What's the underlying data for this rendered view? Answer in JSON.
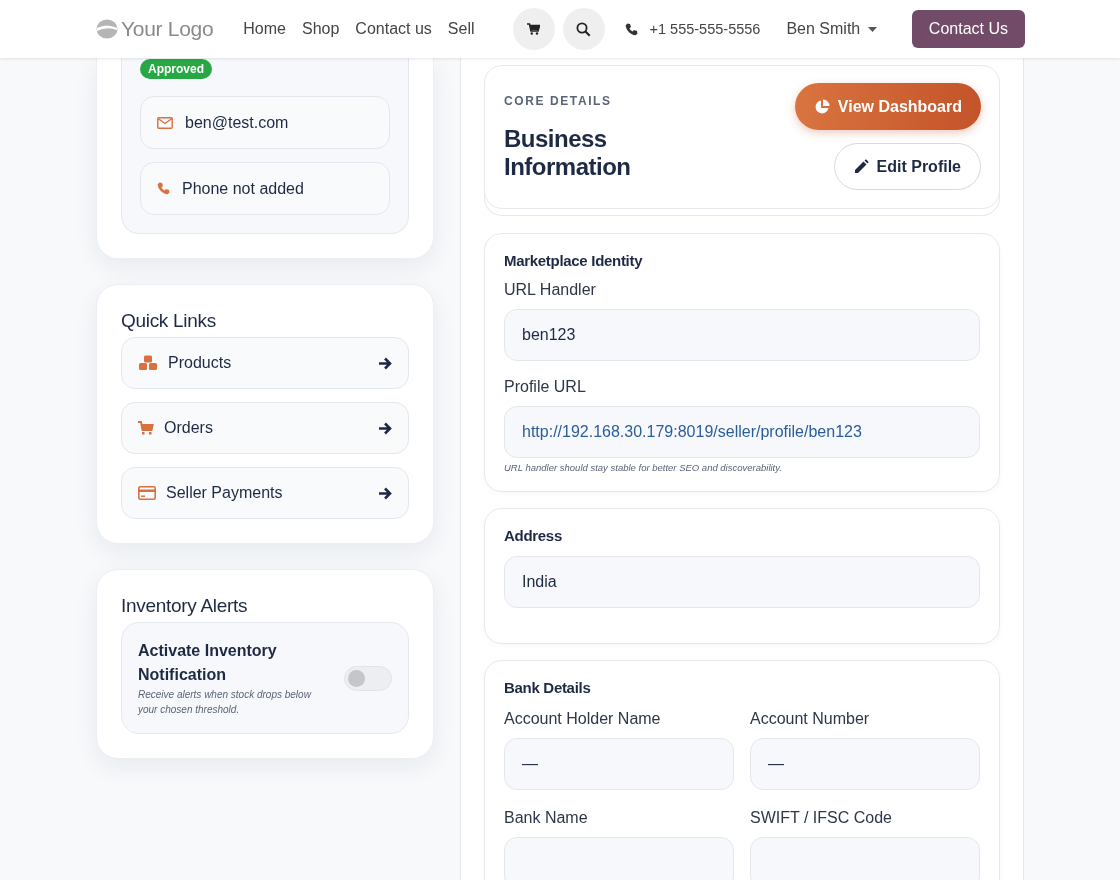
{
  "header": {
    "logo": "Your Logo",
    "nav": [
      {
        "label": "Home"
      },
      {
        "label": "Shop"
      },
      {
        "label": "Contact us"
      },
      {
        "label": "Sell"
      }
    ],
    "phone": "+1 555-555-5556",
    "user": "Ben Smith",
    "cta": "Contact Us"
  },
  "profile": {
    "status": "Approved",
    "email": "ben@test.com",
    "phone": "Phone not added"
  },
  "quick_links": {
    "title": "Quick Links",
    "items": [
      {
        "kind": "products",
        "label": "Products"
      },
      {
        "kind": "orders",
        "label": "Orders"
      },
      {
        "kind": "payments",
        "label": "Seller Payments"
      }
    ]
  },
  "inventory_alerts": {
    "title": "Inventory Alerts",
    "toggle_label": "Activate Inventory Notification",
    "hint": "Receive alerts when stock drops below your chosen threshold.",
    "on": false
  },
  "core": {
    "eyebrow": "CORE DETAILS",
    "title": "Business Information",
    "buttons": [
      {
        "kind": "primary",
        "label": "View Dashboard"
      },
      {
        "kind": "outline",
        "label": "Edit Profile"
      }
    ]
  },
  "marketplace": {
    "title": "Marketplace Identity",
    "fields": [
      {
        "kind": "text",
        "label": "URL Handler",
        "value": "ben123"
      },
      {
        "kind": "link",
        "label": "Profile URL",
        "value": "http://192.168.30.179:8019/seller/profile/ben123"
      }
    ],
    "note": "URL handler should stay stable for better SEO and discoverability."
  },
  "address": {
    "title": "Address",
    "value": "India"
  },
  "bank": {
    "title": "Bank Details",
    "fields": [
      {
        "label": "Account Holder Name",
        "value": "—"
      },
      {
        "label": "Account Number",
        "value": "—"
      },
      {
        "label": "Bank Name"
      },
      {
        "label": "SWIFT / IFSC Code"
      }
    ]
  }
}
